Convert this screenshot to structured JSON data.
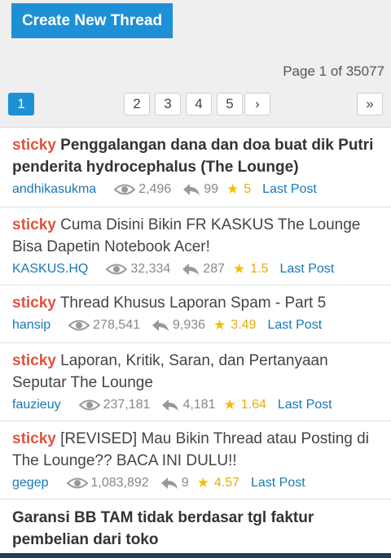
{
  "header": {
    "create_label": "Create New Thread",
    "page_info": "Page 1 of 35077"
  },
  "pagination": {
    "current": "1",
    "pages": [
      "2",
      "3",
      "4",
      "5"
    ],
    "next": "›",
    "last": "»"
  },
  "sticky_label": "sticky",
  "threads": [
    {
      "sticky": true,
      "title": "Penggalangan dana dan doa buat dik Putri penderita hydrocephalus (The Lounge)",
      "bold": true,
      "author": "andhikasukma",
      "views": "2,496",
      "replies": "99",
      "rating": "5",
      "last_post": "Last Post"
    },
    {
      "sticky": true,
      "title": "Cuma Disini Bikin FR KASKUS The Lounge Bisa Dapetin Notebook Acer!",
      "bold": false,
      "author": "KASKUS.HQ",
      "views": "32,334",
      "replies": "287",
      "rating": "1.5",
      "last_post": "Last Post"
    },
    {
      "sticky": true,
      "title": "Thread Khusus Laporan Spam - Part 5",
      "bold": false,
      "author": "hansip",
      "views": "278,541",
      "replies": "9,936",
      "rating": "3.49",
      "last_post": "Last Post"
    },
    {
      "sticky": true,
      "title": "Laporan, Kritik, Saran, dan Pertanyaan Seputar The Lounge",
      "bold": false,
      "author": "fauzieuy",
      "views": "237,181",
      "replies": "4,181",
      "rating": "1.64",
      "last_post": "Last Post"
    },
    {
      "sticky": true,
      "title": "[REVISED] Mau Bikin Thread atau Posting di The Lounge?? BACA INI DULU!!",
      "bold": false,
      "author": "gegep",
      "views": "1,083,892",
      "replies": "9",
      "rating": "4.57",
      "last_post": "Last Post"
    },
    {
      "sticky": false,
      "title": "Garansi BB TAM tidak berdasar tgl faktur pembelian dari toko",
      "bold": true
    }
  ]
}
